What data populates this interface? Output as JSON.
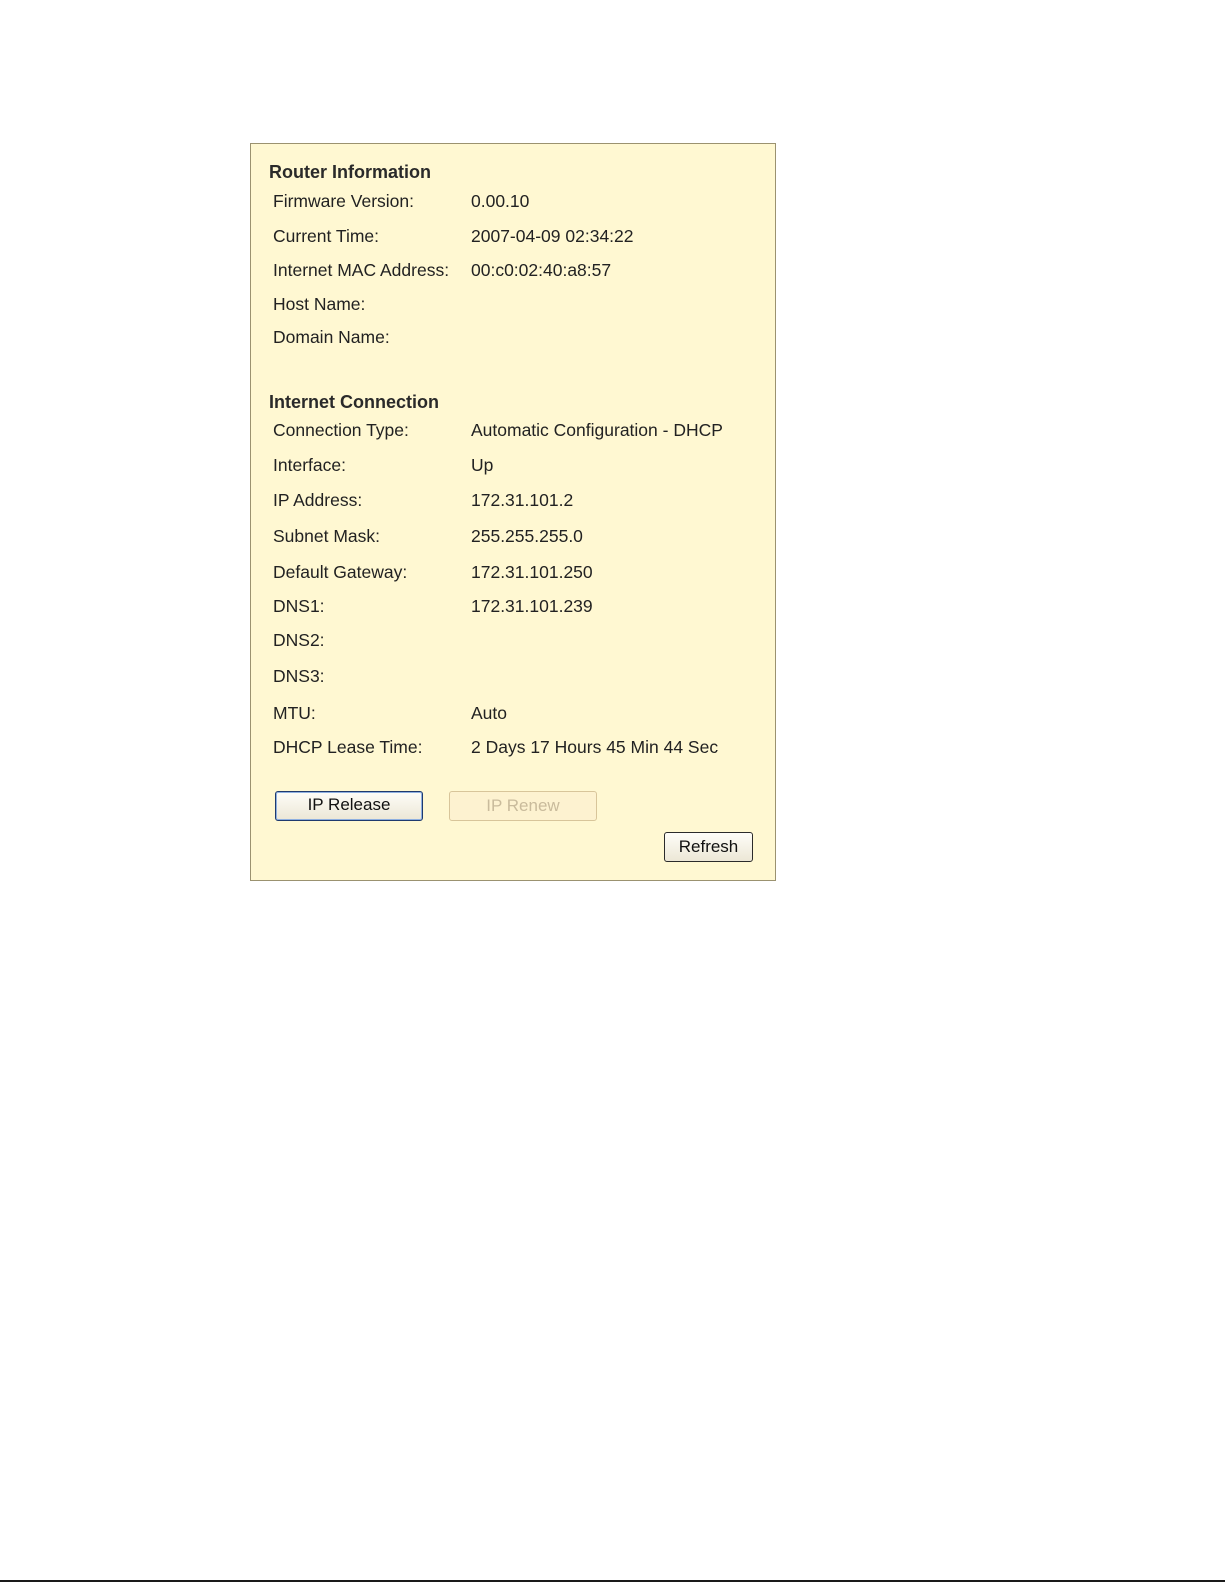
{
  "router_info": {
    "title": "Router Information",
    "rows": [
      {
        "label": "Firmware Version:",
        "value": "0.00.10"
      },
      {
        "label": "Current Time:",
        "value": "2007-04-09 02:34:22"
      },
      {
        "label": "Internet MAC Address:",
        "value": "00:c0:02:40:a8:57"
      },
      {
        "label": "Host Name:",
        "value": ""
      },
      {
        "label": "Domain Name:",
        "value": ""
      }
    ]
  },
  "internet_connection": {
    "title": "Internet Connection",
    "rows": [
      {
        "label": "Connection Type:",
        "value": "Automatic Configuration - DHCP"
      },
      {
        "label": "Interface:",
        "value": "Up"
      },
      {
        "label": "IP Address:",
        "value": "172.31.101.2"
      },
      {
        "label": "Subnet Mask:",
        "value": "255.255.255.0"
      },
      {
        "label": "Default Gateway:",
        "value": "172.31.101.250"
      },
      {
        "label": "DNS1:",
        "value": "172.31.101.239"
      },
      {
        "label": "DNS2:",
        "value": ""
      },
      {
        "label": "DNS3:",
        "value": ""
      },
      {
        "label": "MTU:",
        "value": "Auto"
      },
      {
        "label": "DHCP Lease Time:",
        "value": "2 Days 17 Hours 45 Min 44 Sec"
      }
    ]
  },
  "buttons": {
    "ip_release": "IP Release",
    "ip_renew": "IP Renew",
    "refresh": "Refresh"
  },
  "colors": {
    "panel_background": "#fff8d2",
    "panel_border": "#9b9270",
    "disabled_text": "#c9bb9c"
  }
}
